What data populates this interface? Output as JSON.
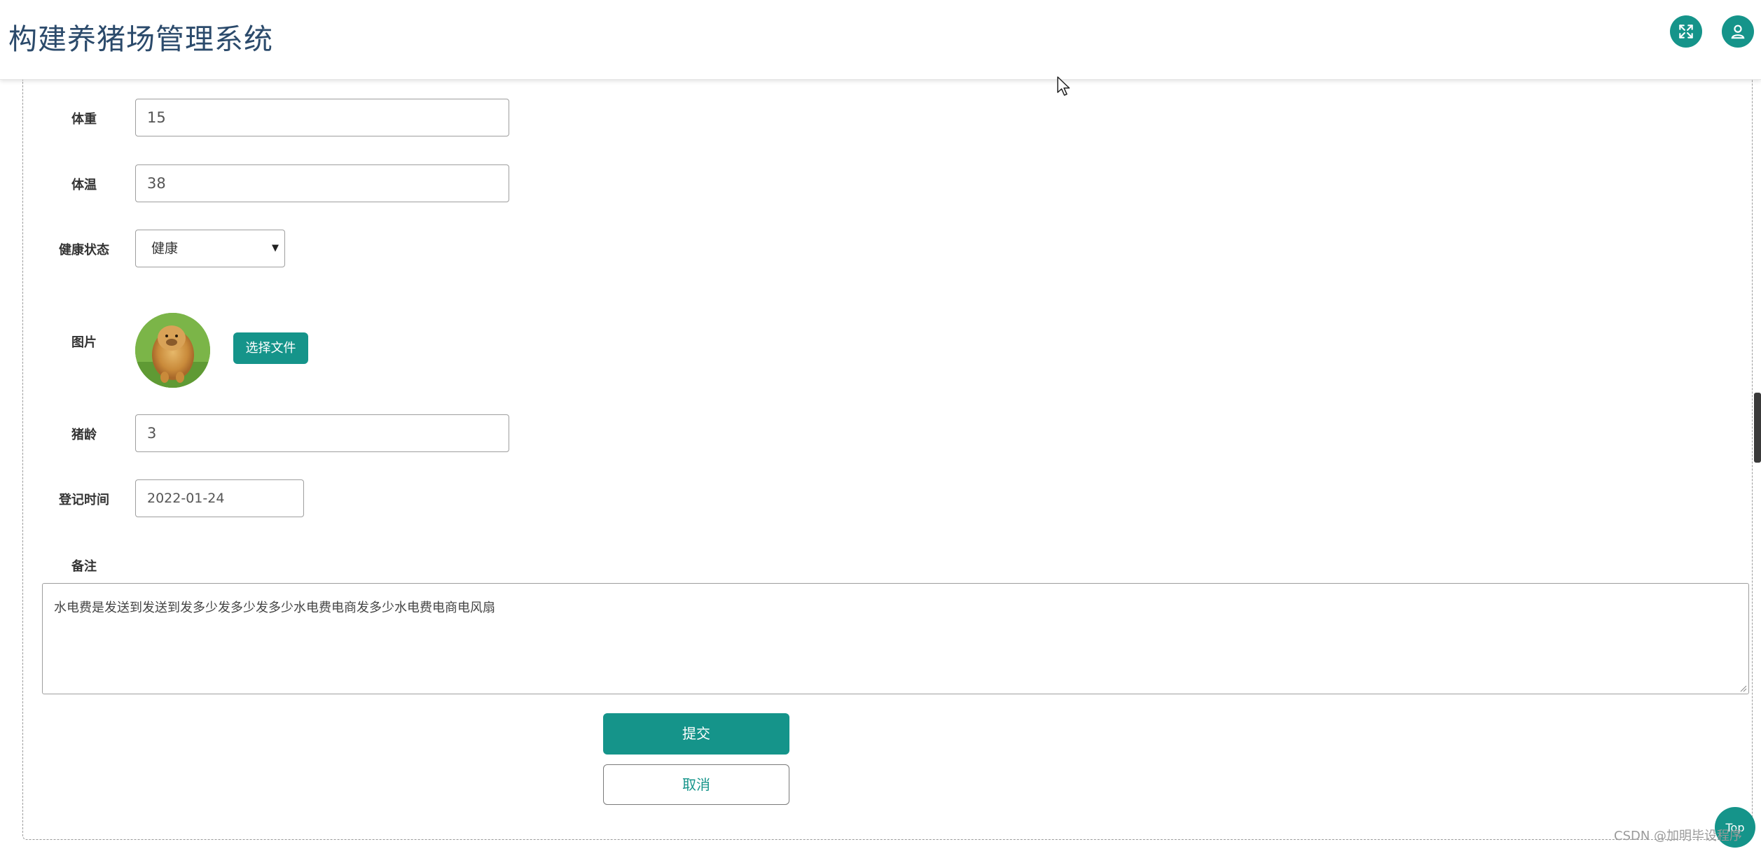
{
  "header": {
    "title": "构建养猪场管理系统",
    "fullscreen_icon": "expand-arrows-icon",
    "user_icon": "user-icon",
    "accent_color": "#15948a"
  },
  "form": {
    "weight": {
      "label": "体重",
      "value": "15"
    },
    "temperature": {
      "label": "体温",
      "value": "38"
    },
    "health": {
      "label": "健康状态",
      "selected": "健康"
    },
    "image": {
      "label": "图片",
      "button_label": "选择文件"
    },
    "age": {
      "label": "猪龄",
      "value": "3"
    },
    "register_time": {
      "label": "登记时间",
      "value": "2022-01-24"
    },
    "remark": {
      "label": "备注",
      "value": "水电费是发送到发送到发多少发多少发多少水电费电商发多少水电费电商电风扇"
    },
    "submit_label": "提交",
    "cancel_label": "取消"
  },
  "floating": {
    "top_label": "Top"
  },
  "watermark": "CSDN @加明毕设程序"
}
